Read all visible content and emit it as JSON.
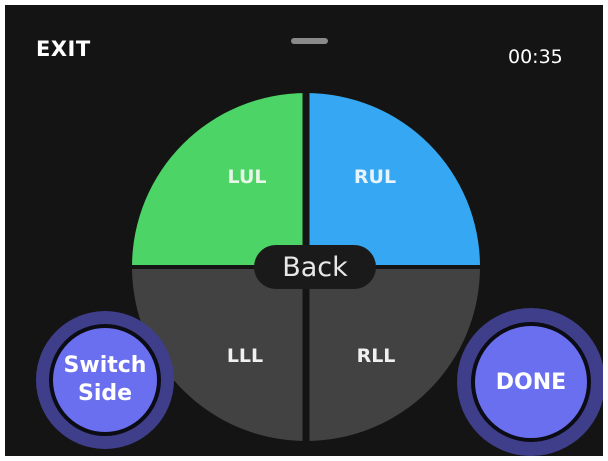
{
  "header": {
    "exit_label": "EXIT",
    "timer": "00:35"
  },
  "wheel": {
    "quadrants": [
      {
        "id": "LUL",
        "label": "LUL",
        "color": "#4cd466",
        "label_color": "#e8f6e8"
      },
      {
        "id": "RUL",
        "label": "RUL",
        "color": "#36a8f3",
        "label_color": "#e8f3fb"
      },
      {
        "id": "LLL",
        "label": "LLL",
        "color": "#424242",
        "label_color": "#f0f0f0"
      },
      {
        "id": "RLL",
        "label": "RLL",
        "color": "#424242",
        "label_color": "#f0f0f0"
      }
    ],
    "back_label": "Back"
  },
  "buttons": {
    "switch_side_line1": "Switch",
    "switch_side_line2": "Side",
    "done_label": "DONE"
  },
  "colors": {
    "background": "#141414",
    "button_fill": "#6a6fef",
    "button_ring": "#3e3e8a"
  }
}
